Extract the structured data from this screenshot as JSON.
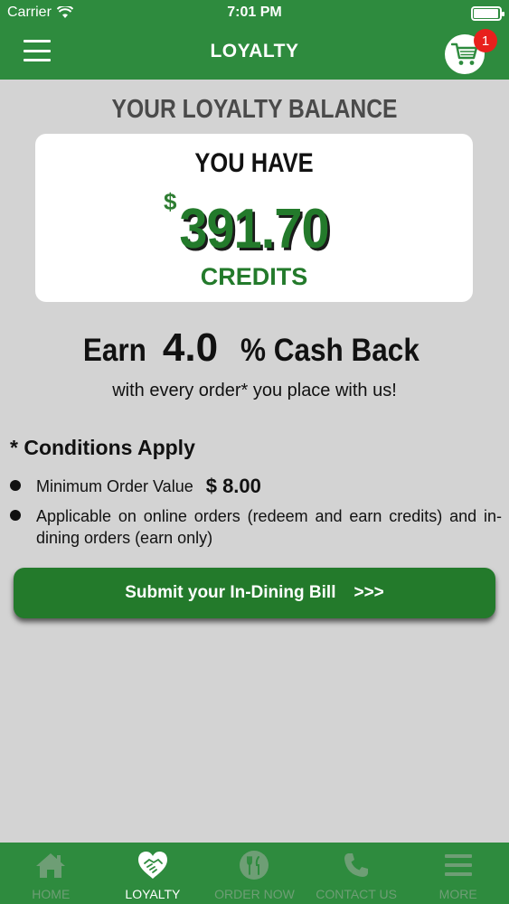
{
  "status": {
    "carrier": "Carrier",
    "time": "7:01 PM",
    "battery_level": 0.95
  },
  "header": {
    "title": "LOYALTY",
    "cart_count": "1"
  },
  "balance": {
    "heading": "YOUR LOYALTY BALANCE",
    "you_have": "YOU HAVE",
    "currency": "$",
    "amount": "391.70",
    "unit": "CREDITS"
  },
  "earn": {
    "prefix": "Earn",
    "percent": "4.0",
    "suffix": "% Cash Back",
    "subline": "with every order* you place with us!"
  },
  "conditions": {
    "title": "* Conditions Apply",
    "min_order_label": "Minimum Order Value",
    "min_order_value": "$ 8.00",
    "applicable_text": "Applicable on online orders (redeem and earn credits) and in-dining orders (earn only)"
  },
  "submit": {
    "label": "Submit your In-Dining Bill",
    "arrows": ">>>"
  },
  "tabs": [
    {
      "label": "HOME",
      "icon": "home-icon"
    },
    {
      "label": "LOYALTY",
      "icon": "loyalty-icon"
    },
    {
      "label": "ORDER NOW",
      "icon": "cutlery-icon"
    },
    {
      "label": "CONTACT US",
      "icon": "phone-icon"
    },
    {
      "label": "MORE",
      "icon": "more-icon"
    }
  ],
  "colors": {
    "brand_green": "#2e8b3e",
    "credit_green": "#237a2b",
    "badge_red": "#e8201c",
    "background": "#d3d3d3"
  }
}
